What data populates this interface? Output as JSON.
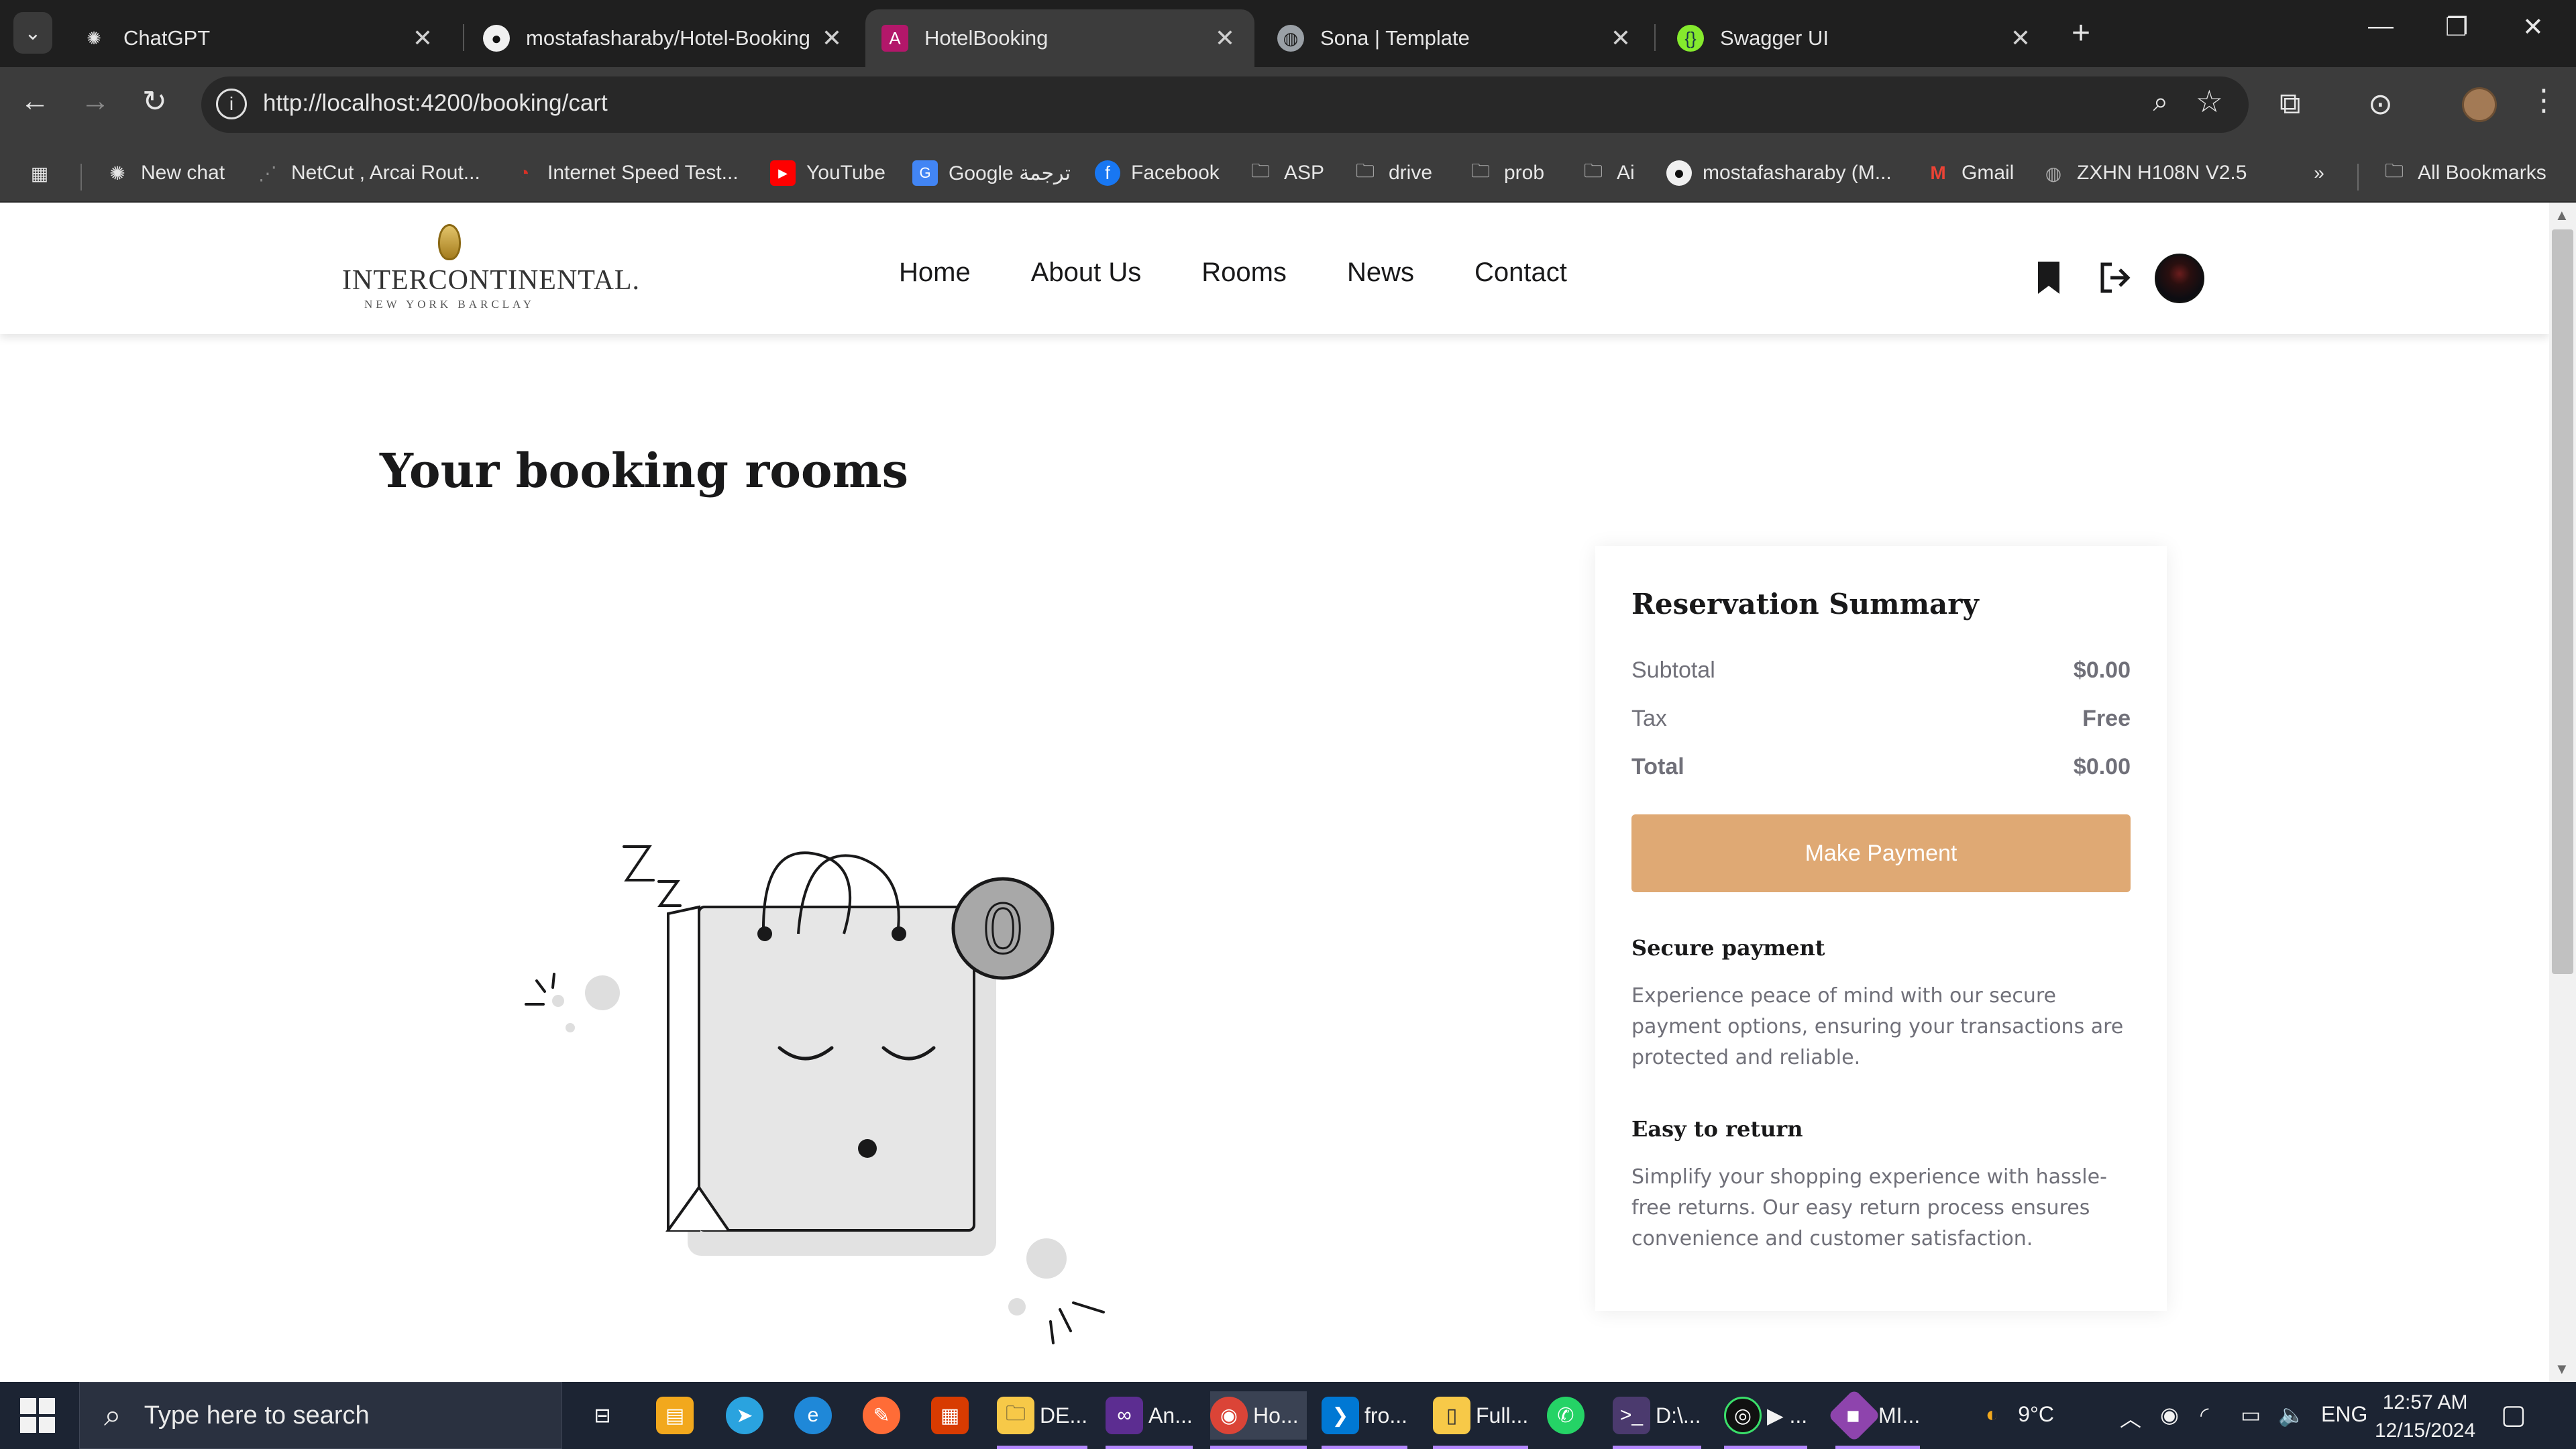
{
  "browser": {
    "tabs": [
      {
        "title": "ChatGPT",
        "icon": "openai-icon",
        "active": false
      },
      {
        "title": "mostafasharaby/Hotel-Booking",
        "icon": "github-icon",
        "active": false
      },
      {
        "title": "HotelBooking",
        "icon": "angular-icon",
        "active": true
      },
      {
        "title": "Sona | Template",
        "icon": "globe-icon",
        "active": false
      },
      {
        "title": "Swagger UI",
        "icon": "swagger-icon",
        "active": false
      }
    ],
    "url": "http://localhost:4200/booking/cart",
    "bookmarks": [
      {
        "label": "New chat"
      },
      {
        "label": "NetCut , Arcai Rout..."
      },
      {
        "label": "Internet Speed Test..."
      },
      {
        "label": "YouTube"
      },
      {
        "label": "Google ترجمة"
      },
      {
        "label": "Facebook"
      },
      {
        "label": "ASP"
      },
      {
        "label": "drive"
      },
      {
        "label": "prob"
      },
      {
        "label": "Ai"
      },
      {
        "label": "mostafasharaby (M..."
      },
      {
        "label": "Gmail"
      },
      {
        "label": "ZXHN H108N V2.5"
      }
    ],
    "all_bookmarks": "All Bookmarks"
  },
  "site": {
    "logo": {
      "brand": "INTERCONTINENTAL.",
      "sub": "NEW YORK BARCLAY"
    },
    "nav": [
      "Home",
      "About Us",
      "Rooms",
      "News",
      "Contact"
    ]
  },
  "cart": {
    "title": "Your booking rooms",
    "badge_count": "0"
  },
  "summary": {
    "title": "Reservation Summary",
    "subtotal_label": "Subtotal",
    "subtotal_value": "$0.00",
    "tax_label": "Tax",
    "tax_value": "Free",
    "total_label": "Total",
    "total_value": "$0.00",
    "pay_button": "Make Payment",
    "secure_title": "Secure payment",
    "secure_text": "Experience peace of mind with our secure payment options, ensuring your transactions are protected and reliable.",
    "return_title": "Easy to return",
    "return_text": "Simplify your shopping experience with hassle-free returns. Our easy return process ensures convenience and customer satisfaction."
  },
  "taskbar": {
    "search_placeholder": "Type here to search",
    "apps": [
      {
        "label": "DE...",
        "icon": "file-explorer-icon"
      },
      {
        "label": "An...",
        "icon": "visual-studio-icon"
      },
      {
        "label": "Ho...",
        "icon": "chrome-icon"
      },
      {
        "label": "fro...",
        "icon": "vscode-icon"
      },
      {
        "label": "Full...",
        "icon": "folder-icon"
      },
      {
        "label": "D:\\...",
        "icon": "terminal-icon"
      },
      {
        "label": "▶ ...",
        "icon": "media-icon"
      },
      {
        "label": "MI...",
        "icon": "git-icon"
      }
    ],
    "weather": "9°C",
    "language": "ENG",
    "time": "12:57 AM",
    "date": "12/15/2024"
  },
  "colors": {
    "accent": "#dfa974",
    "heading": "#19191a",
    "body_text": "#707079",
    "chrome_dark": "#1f1f1f",
    "taskbar": "#1c2433"
  }
}
